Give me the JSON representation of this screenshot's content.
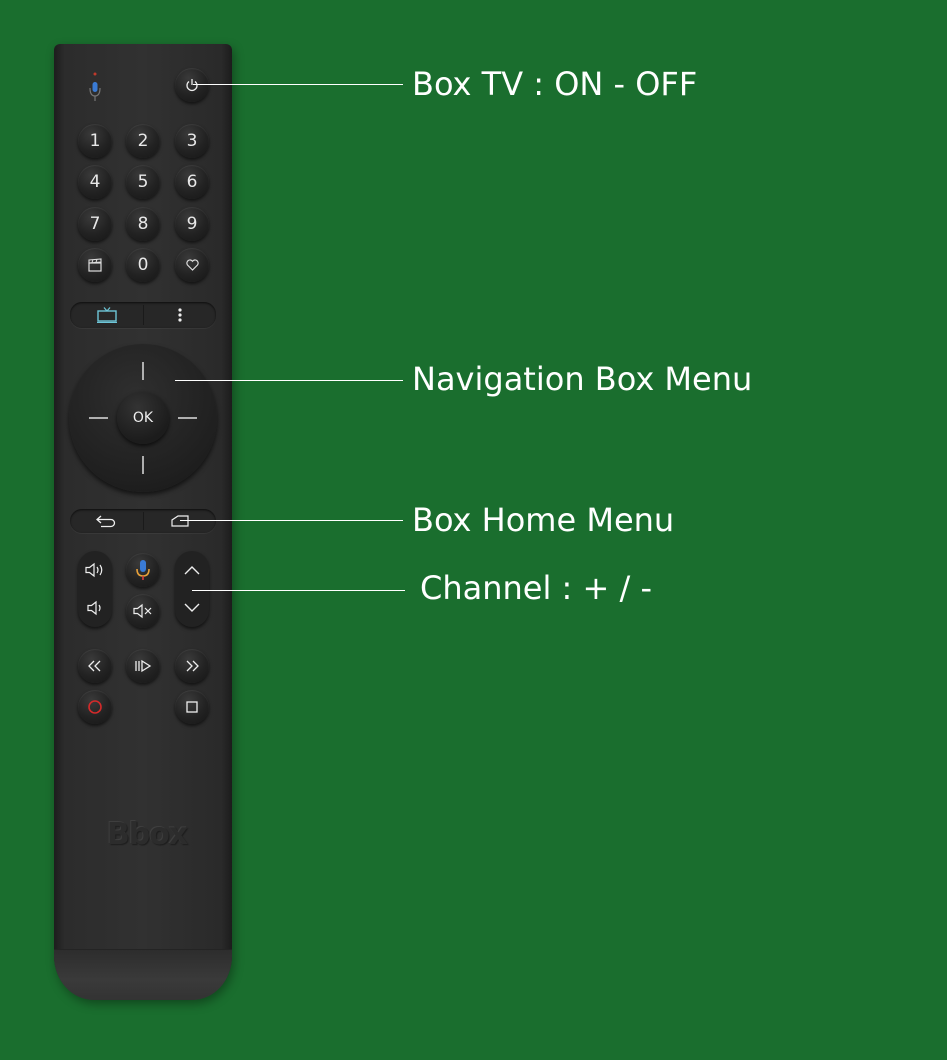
{
  "remote": {
    "digits": [
      "1",
      "2",
      "3",
      "4",
      "5",
      "6",
      "7",
      "8",
      "9",
      "0"
    ],
    "ok_label": "OK",
    "brand": "Bbox"
  },
  "callouts": {
    "power": "Box TV : ON - OFF",
    "navigation": "Navigation Box Menu",
    "home": "Box Home Menu",
    "channel": "Channel : + / -"
  },
  "colors": {
    "background": "#1a6e2e",
    "remote_body": "#2e2e2e",
    "tv_icon": "#6ec6d8",
    "record_icon": "#d42a2a",
    "mic_blue": "#3a7bd5",
    "mic_orange": "#e8a13a"
  }
}
